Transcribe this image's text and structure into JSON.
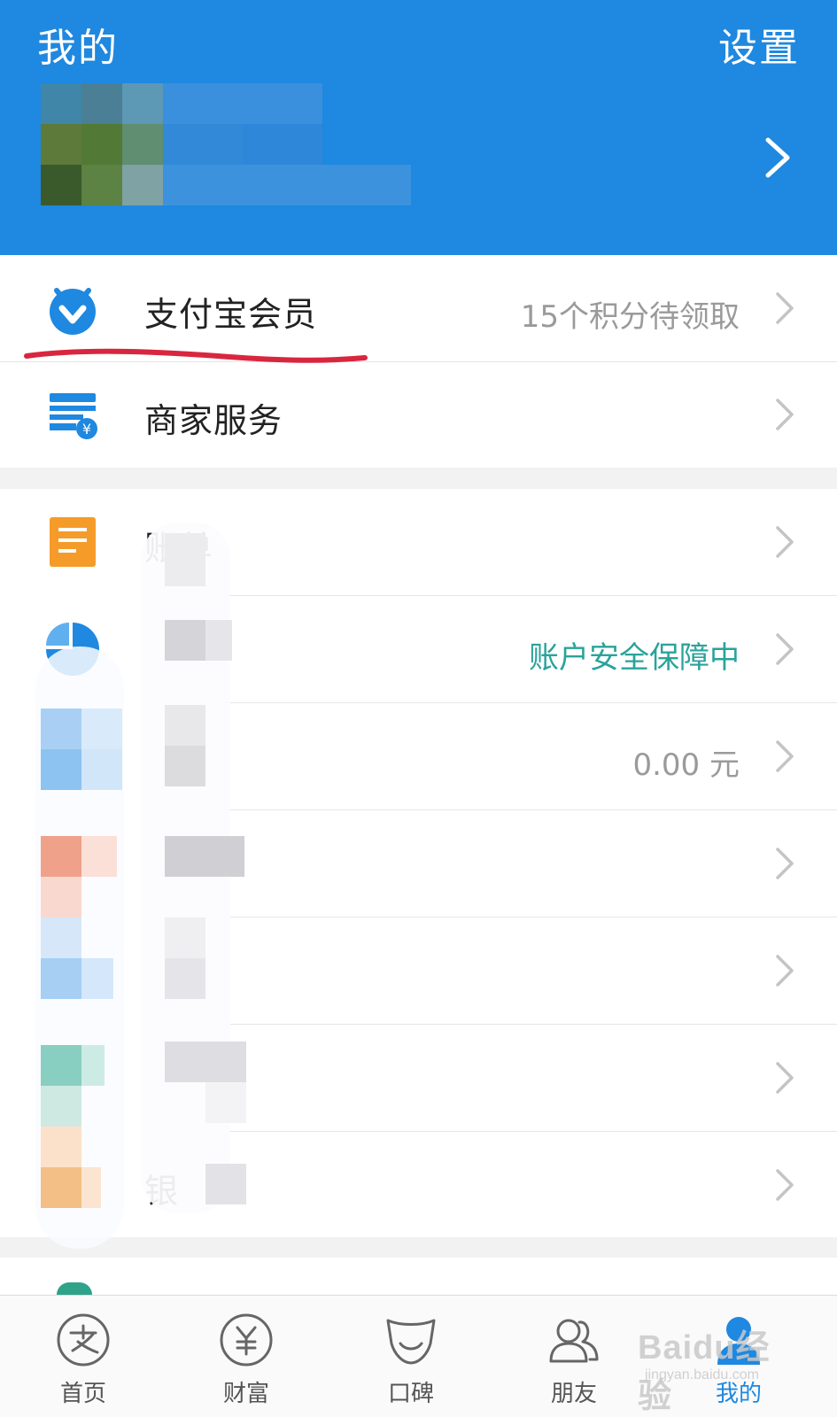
{
  "header": {
    "title": "我的",
    "settings_label": "设置"
  },
  "rows": [
    {
      "label": "支付宝会员",
      "value": "15个积分待领取",
      "icon": "member-badge-icon"
    },
    {
      "label": "商家服务",
      "value": "",
      "icon": "merchant-store-icon"
    },
    {
      "label": "账单",
      "value": "",
      "icon": "bill-icon"
    },
    {
      "label": "",
      "value": "账户安全保障中",
      "icon": "pie-chart-icon"
    },
    {
      "label": "",
      "value": "0.00 元",
      "icon": "balance-icon"
    },
    {
      "label": "",
      "value": "",
      "icon": "treasure-icon"
    },
    {
      "label": "",
      "value": "",
      "icon": "flower-icon"
    },
    {
      "label": "",
      "value": "",
      "icon": "fund-icon"
    },
    {
      "label": "银",
      "value": "",
      "icon": "bank-card-icon"
    }
  ],
  "tabs": [
    {
      "label": "首页",
      "icon": "alipay-home-icon"
    },
    {
      "label": "财富",
      "icon": "wealth-yen-icon"
    },
    {
      "label": "口碑",
      "icon": "koubei-icon"
    },
    {
      "label": "朋友",
      "icon": "friends-icon"
    },
    {
      "label": "我的",
      "icon": "me-person-icon",
      "active": true
    }
  ],
  "watermark": {
    "brand": "Baidu经验",
    "url": "jingyan.baidu.com"
  },
  "colors": {
    "header_blue": "#1f88e0",
    "annotation_red": "#d9263f",
    "security_teal": "#2aa39a"
  }
}
